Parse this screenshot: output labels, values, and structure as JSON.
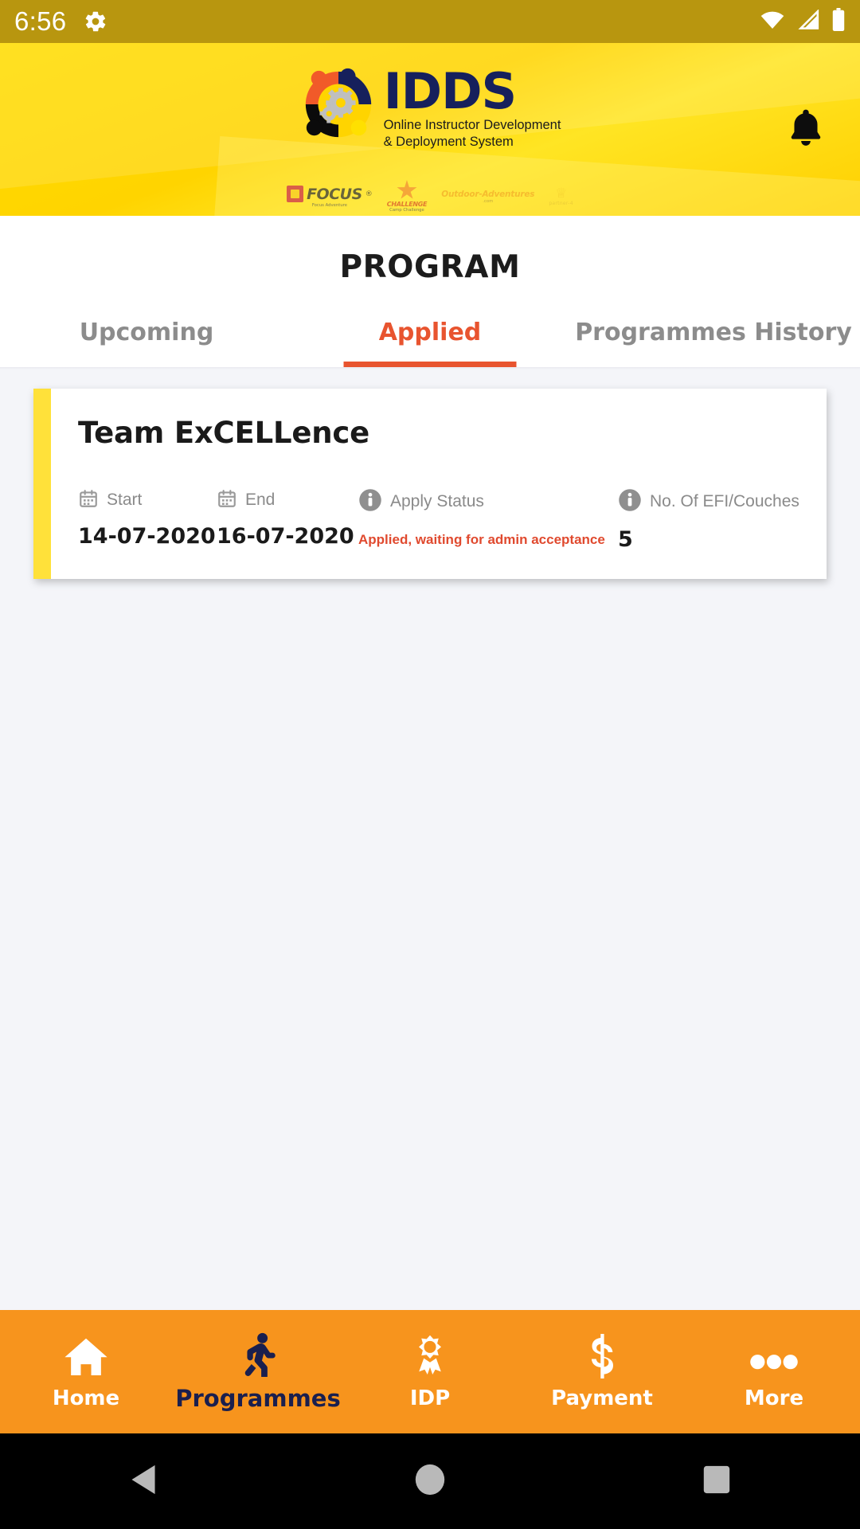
{
  "status_bar": {
    "time": "6:56",
    "icons": [
      "gear-icon",
      "wifi-icon",
      "cellular-signal-icon",
      "battery-icon"
    ]
  },
  "header": {
    "logo_title": "IDDS",
    "logo_subtitle_line1": "Online Instructor Development",
    "logo_subtitle_line2": "& Deployment System",
    "notification_icon": "bell-icon",
    "partners": [
      {
        "name": "FOCUS",
        "caption": "Focus Adventure"
      },
      {
        "name": "CHALLENGE",
        "caption": "Camp Challenge"
      },
      {
        "name": "Outdoor-Adventures",
        "caption": ".com"
      },
      {
        "name": "partner-4",
        "caption": ""
      }
    ]
  },
  "page": {
    "title": "PROGRAM"
  },
  "tabs": [
    {
      "label": "Upcoming",
      "active": false
    },
    {
      "label": "Applied",
      "active": true
    },
    {
      "label": "Programmes History",
      "active": false
    }
  ],
  "programs": [
    {
      "title": "Team ExCELLence",
      "start_label": "Start",
      "start_icon": "calendar-icon",
      "start_value": "14-07-2020",
      "end_label": "End",
      "end_icon": "calendar-icon",
      "end_value": "16-07-2020",
      "status_label": "Apply Status",
      "status_icon": "info-icon",
      "status_value": "Applied, waiting for admin acceptance",
      "count_label": "No. Of EFI/Couches",
      "count_icon": "info-icon",
      "count_value": "5"
    }
  ],
  "bottom_nav": [
    {
      "label": "Home",
      "icon": "home-icon",
      "active": false
    },
    {
      "label": "Programmes",
      "icon": "running-person-icon",
      "active": true
    },
    {
      "label": "IDP",
      "icon": "award-ribbon-icon",
      "active": false
    },
    {
      "label": "Payment",
      "icon": "dollar-sign-icon",
      "active": false
    },
    {
      "label": "More",
      "icon": "ellipsis-icon",
      "active": false
    }
  ],
  "system_nav": [
    {
      "name": "back-button",
      "icon": "triangle-left-icon"
    },
    {
      "name": "home-button",
      "icon": "circle-icon"
    },
    {
      "name": "recents-button",
      "icon": "square-icon"
    }
  ],
  "colors": {
    "status_bar": "#B8960F",
    "header_yellow": "#FFD400",
    "accent_orange": "#E8542F",
    "nav_orange": "#F7941D",
    "card_accent": "#FFE13A",
    "status_red": "#E04A2F",
    "navy": "#16205C"
  }
}
